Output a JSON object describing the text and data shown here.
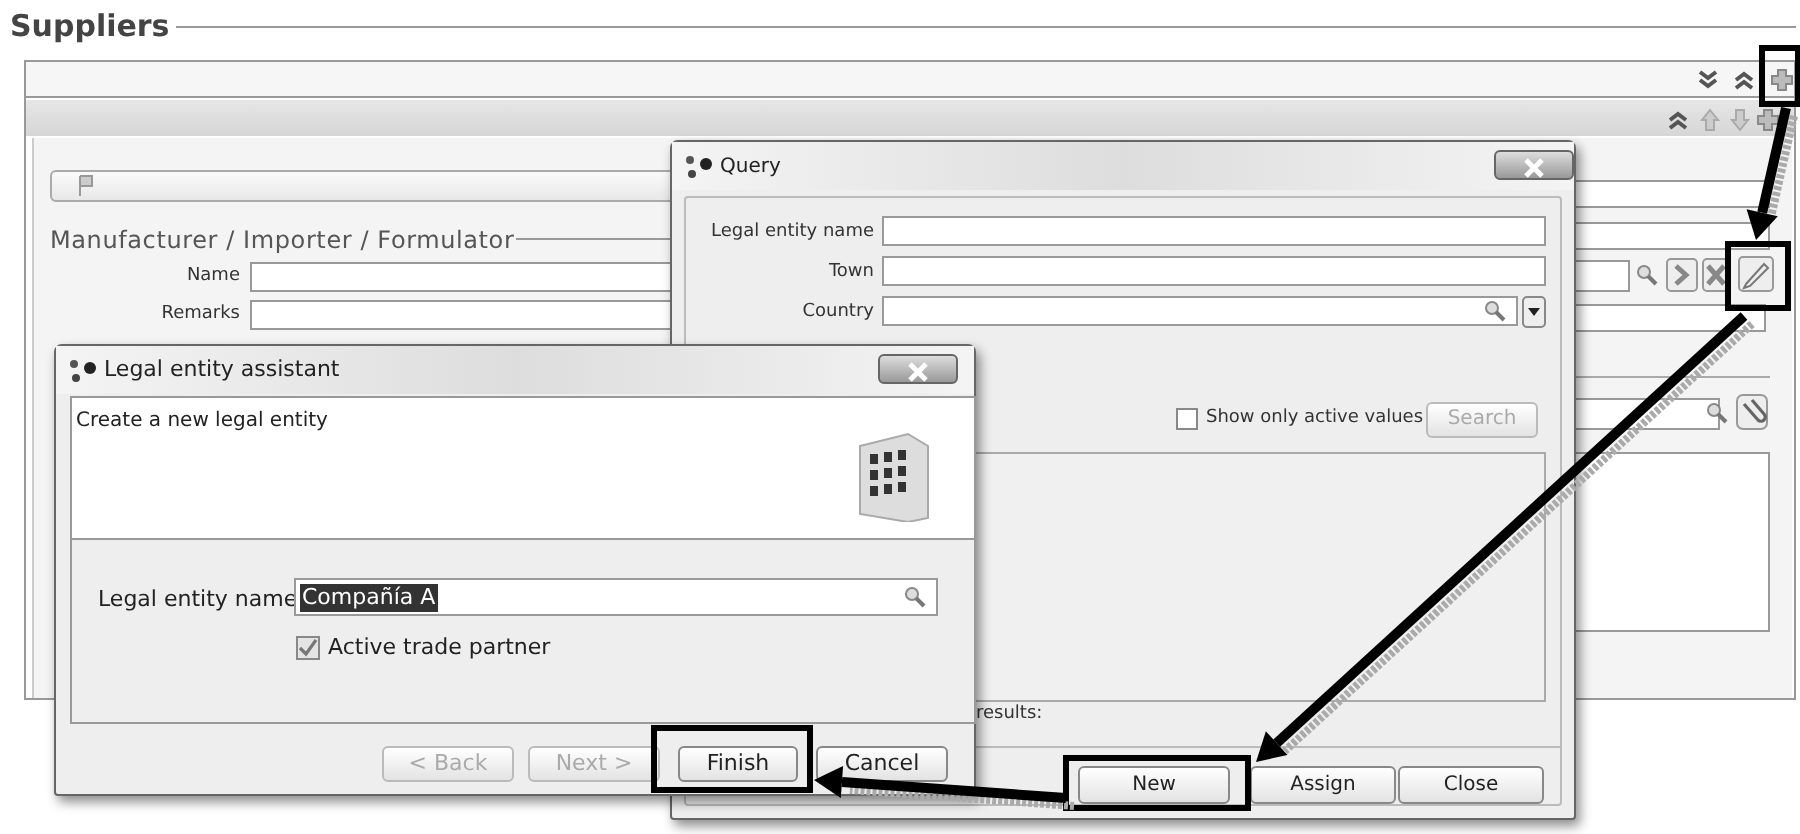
{
  "page": {
    "title": "Suppliers"
  },
  "section": {
    "title": "Manufacturer / Importer / Formulator",
    "fields": [
      {
        "label": "Name"
      },
      {
        "label": "Remarks"
      }
    ]
  },
  "query_dialog": {
    "title": "Query",
    "fields": [
      {
        "label": "Legal entity name",
        "kind": "text"
      },
      {
        "label": "Town",
        "kind": "text"
      },
      {
        "label": "Country",
        "kind": "lookup"
      }
    ],
    "active_only": {
      "label": "Show only active values",
      "checked": false
    },
    "search_button": {
      "label": "Search",
      "disabled": true
    },
    "results_label": "results:",
    "buttons": [
      {
        "label": "New",
        "disabled": false
      },
      {
        "label": "Assign",
        "disabled": false
      },
      {
        "label": "Close",
        "disabled": false
      }
    ]
  },
  "assistant_dialog": {
    "title": "Legal entity assistant",
    "heading": "Create a new legal entity",
    "name_field": {
      "label": "Legal entity name",
      "value": "Compañía A",
      "selected": true
    },
    "active_partner": {
      "label": "Active trade partner",
      "checked": true
    },
    "buttons": [
      {
        "label": "< Back",
        "disabled": true
      },
      {
        "label": "Next >",
        "disabled": true
      },
      {
        "label": "Finish",
        "disabled": false
      },
      {
        "label": "Cancel",
        "disabled": false
      }
    ]
  }
}
